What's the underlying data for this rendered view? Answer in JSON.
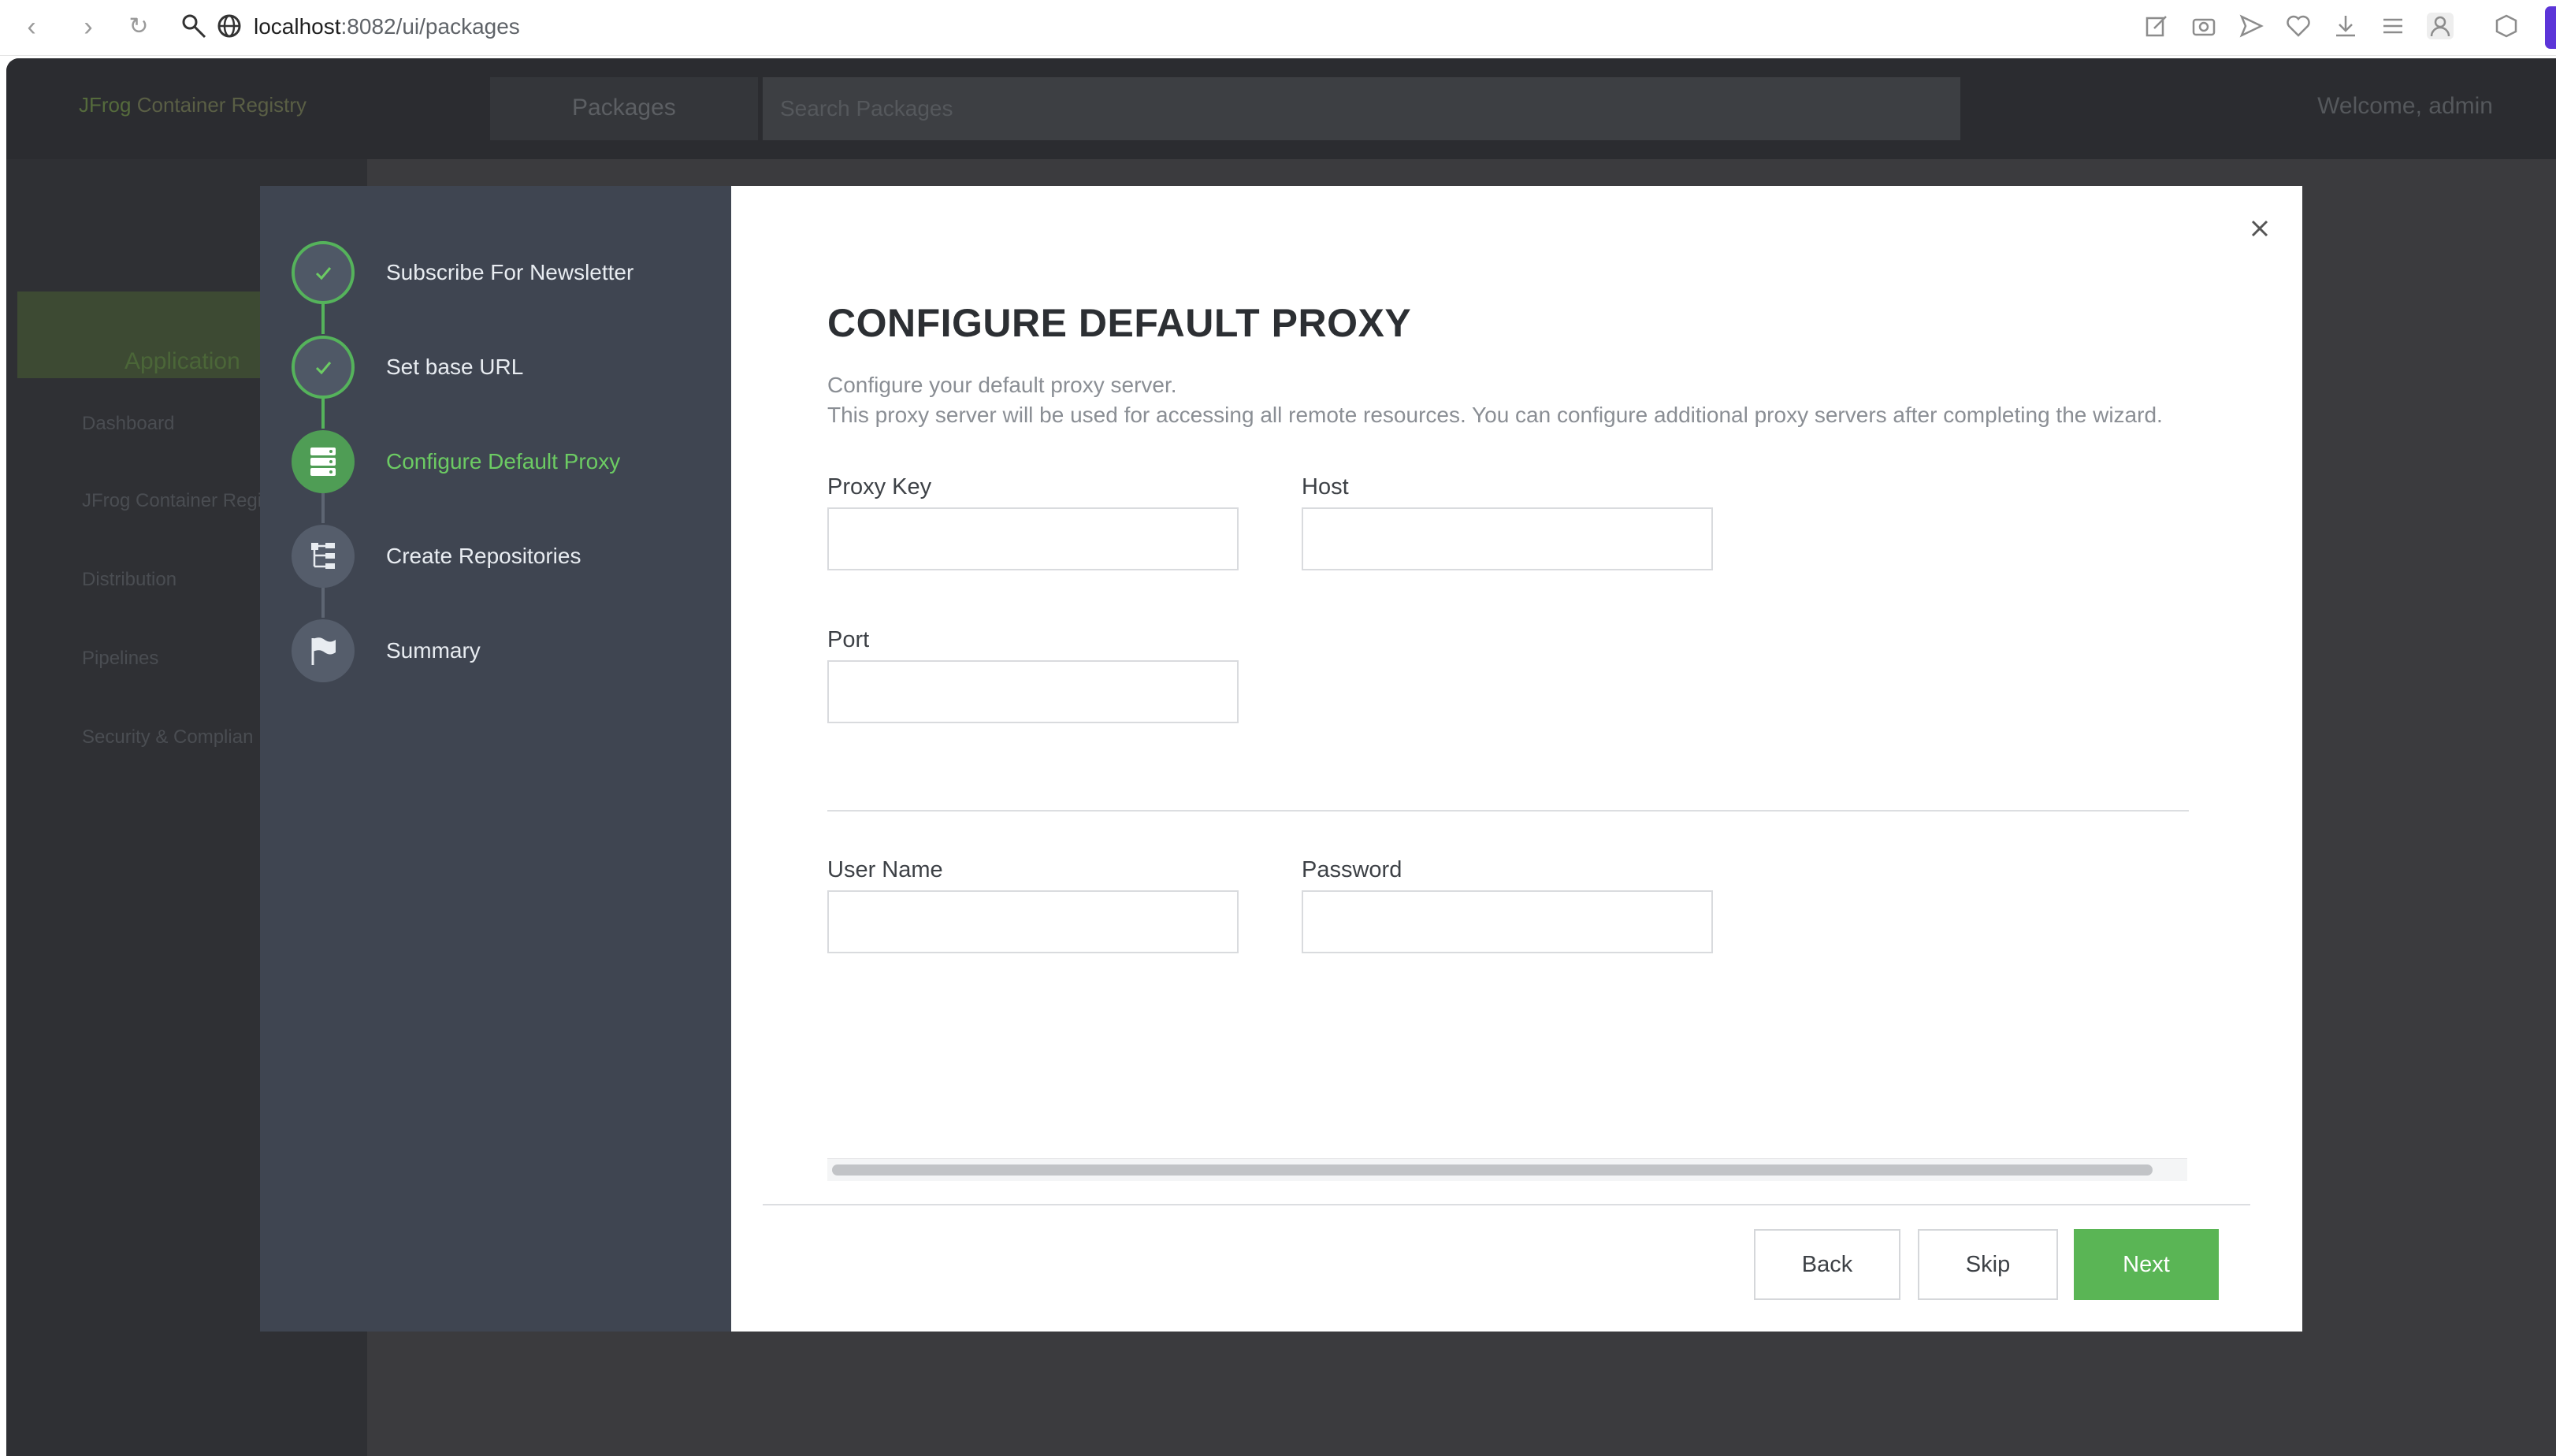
{
  "browser": {
    "url_host": "localhost",
    "url_path": ":8082/ui/packages"
  },
  "app": {
    "brand_prefix": "JFrog",
    "brand_name": "Container Registry",
    "packages_label": "Packages",
    "search_placeholder": "Search Packages",
    "welcome": "Welcome, admin",
    "side_tab": "Application",
    "side_items": [
      "Dashboard",
      "JFrog Container Regi",
      "Distribution",
      "Pipelines",
      "Security & Complian"
    ]
  },
  "wizard": {
    "steps": [
      {
        "label": "Subscribe For Newsletter",
        "state": "done",
        "icon": "check-icon"
      },
      {
        "label": "Set base URL",
        "state": "done",
        "icon": "check-icon"
      },
      {
        "label": "Configure Default Proxy",
        "state": "active",
        "icon": "server-icon"
      },
      {
        "label": "Create Repositories",
        "state": "pending",
        "icon": "tree-icon"
      },
      {
        "label": "Summary",
        "state": "pending",
        "icon": "flag-icon"
      }
    ],
    "title": "CONFIGURE DEFAULT PROXY",
    "desc_line1": "Configure your default proxy server.",
    "desc_line2": "This proxy server will be used for accessing all remote resources. You can configure additional proxy servers after completing the wizard.",
    "fields": {
      "proxy_key": {
        "label": "Proxy Key",
        "value": ""
      },
      "host": {
        "label": "Host",
        "value": ""
      },
      "port": {
        "label": "Port",
        "value": ""
      },
      "user_name": {
        "label": "User Name",
        "value": ""
      },
      "password": {
        "label": "Password",
        "value": ""
      }
    },
    "buttons": {
      "back": "Back",
      "skip": "Skip",
      "next": "Next"
    }
  },
  "colors": {
    "accent_green": "#5ab555",
    "sidebar_bg": "#3f4551"
  }
}
